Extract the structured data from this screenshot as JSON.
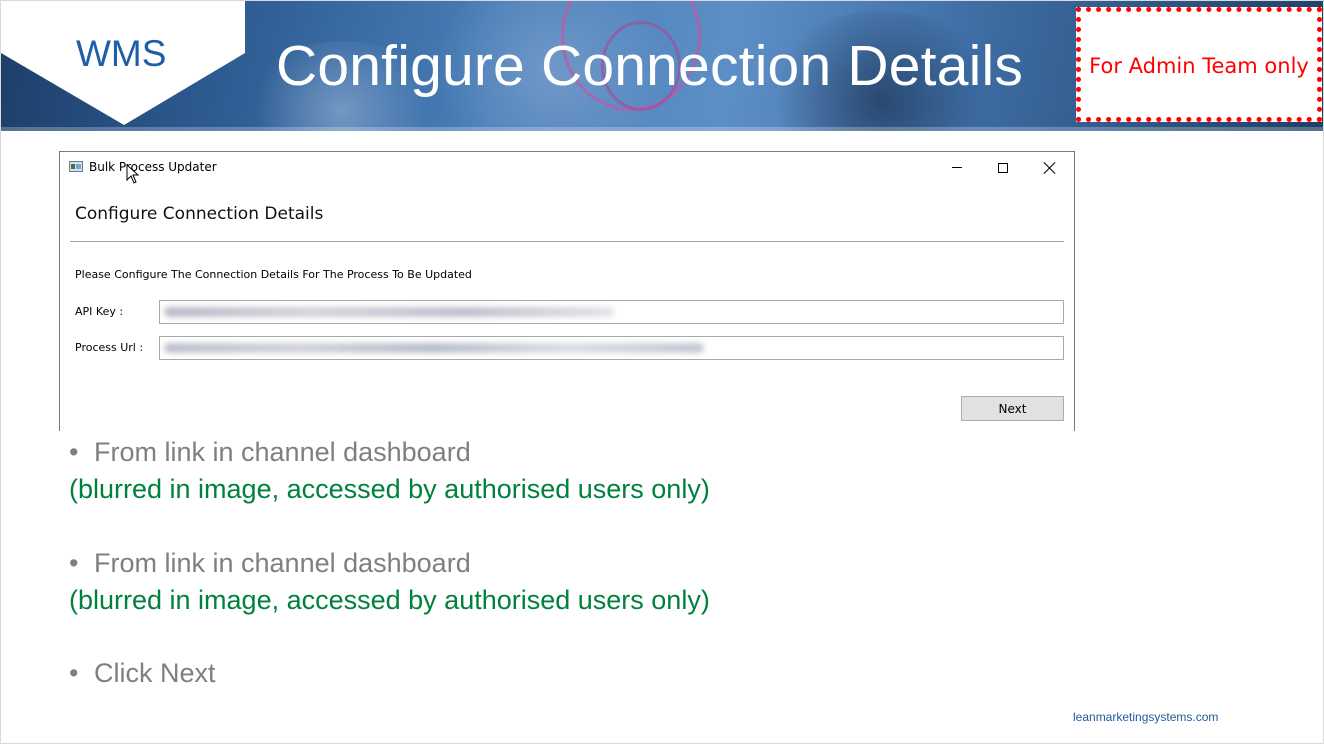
{
  "header": {
    "logo_text": "WMS",
    "title": "Configure Connection Details",
    "admin_note": "For Admin Team only"
  },
  "dialog": {
    "window_title": "Bulk Process Updater",
    "heading": "Configure Connection Details",
    "instruction": "Please Configure The Connection Details For The Process To Be Updated",
    "fields": {
      "api_key_label": "API Key :",
      "api_key_value": "",
      "process_url_label": "Process Url :",
      "process_url_value": ""
    },
    "next_label": "Next"
  },
  "bullets": [
    {
      "text": "From link in channel dashboard",
      "note": "(blurred in image, accessed by authorised users only)"
    },
    {
      "text": "From link in channel dashboard",
      "note": "(blurred in image, accessed by authorised users only)"
    },
    {
      "text": "Click Next"
    }
  ],
  "footer": {
    "site": "leanmarketingsystems.com"
  },
  "colors": {
    "title_text": "#ffffff",
    "logo_blue": "#1e5ea8",
    "admin_red": "#ff0000",
    "bullet_gray": "#7f7f7f",
    "note_green": "#00813d"
  }
}
